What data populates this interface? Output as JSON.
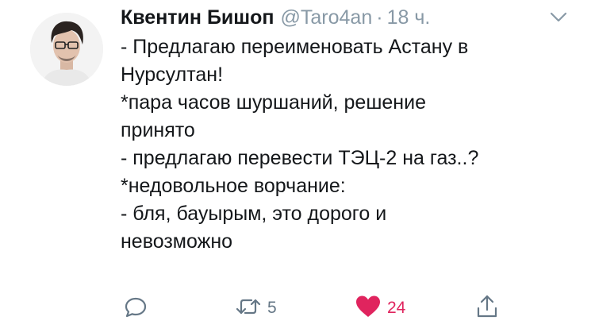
{
  "author": {
    "name": "Квентин Бишоп",
    "handle": "@Taro4an",
    "separator": "·",
    "time": "18 ч."
  },
  "tweet": {
    "lines": [
      "- Предлагаю переименовать Астану в",
      "Нурсултан!",
      "*пара часов шуршаний, решение",
      "принято",
      "- предлагаю перевести ТЭЦ-2 на газ..?",
      "*недовольное ворчание:",
      "- бля, бауырым, это дорого и",
      "невозможно"
    ]
  },
  "actions": {
    "reply": {
      "icon": "reply-icon"
    },
    "retweet": {
      "icon": "retweet-icon",
      "count": "5"
    },
    "like": {
      "icon": "heart-icon",
      "count": "24",
      "liked": true
    },
    "share": {
      "icon": "share-icon"
    }
  },
  "colors": {
    "text": "#14171a",
    "secondary": "#8899a6",
    "icon": "#657786",
    "like": "#e0245e"
  }
}
